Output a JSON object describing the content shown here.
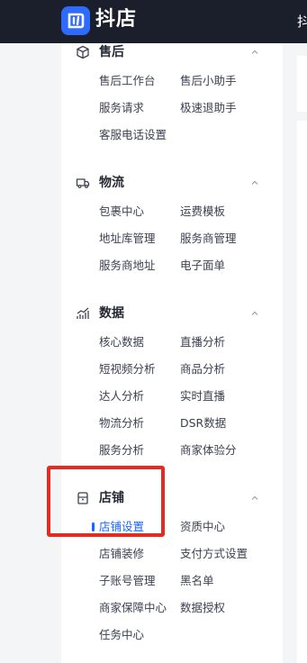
{
  "header": {
    "brand": "抖店",
    "right_text": "抖"
  },
  "sidebar": {
    "sections": [
      {
        "title": "售后",
        "icon": "package-icon",
        "items": [
          "售后工作台",
          "售后小助手",
          "服务请求",
          "极速退助手",
          "客服电话设置"
        ]
      },
      {
        "title": "物流",
        "icon": "truck-icon",
        "items": [
          "包裹中心",
          "运费模板",
          "地址库管理",
          "服务商管理",
          "服务商地址",
          "电子面单"
        ]
      },
      {
        "title": "数据",
        "icon": "chart-icon",
        "items": [
          "核心数据",
          "直播分析",
          "短视频分析",
          "商品分析",
          "达人分析",
          "实时直播",
          "物流分析",
          "DSR数据",
          "服务分析",
          "商家体验分"
        ]
      },
      {
        "title": "店铺",
        "icon": "store-icon",
        "items": [
          "店铺设置",
          "资质中心",
          "店铺装修",
          "支付方式设置",
          "子账号管理",
          "黑名单",
          "商家保障中心",
          "数据授权",
          "任务中心"
        ],
        "active_item": "店铺设置"
      }
    ]
  },
  "colors": {
    "topbar": "#1b1f2b",
    "brand_blue": "#2d6bff",
    "active": "#1966ff",
    "highlight_box": "#e42a21"
  }
}
